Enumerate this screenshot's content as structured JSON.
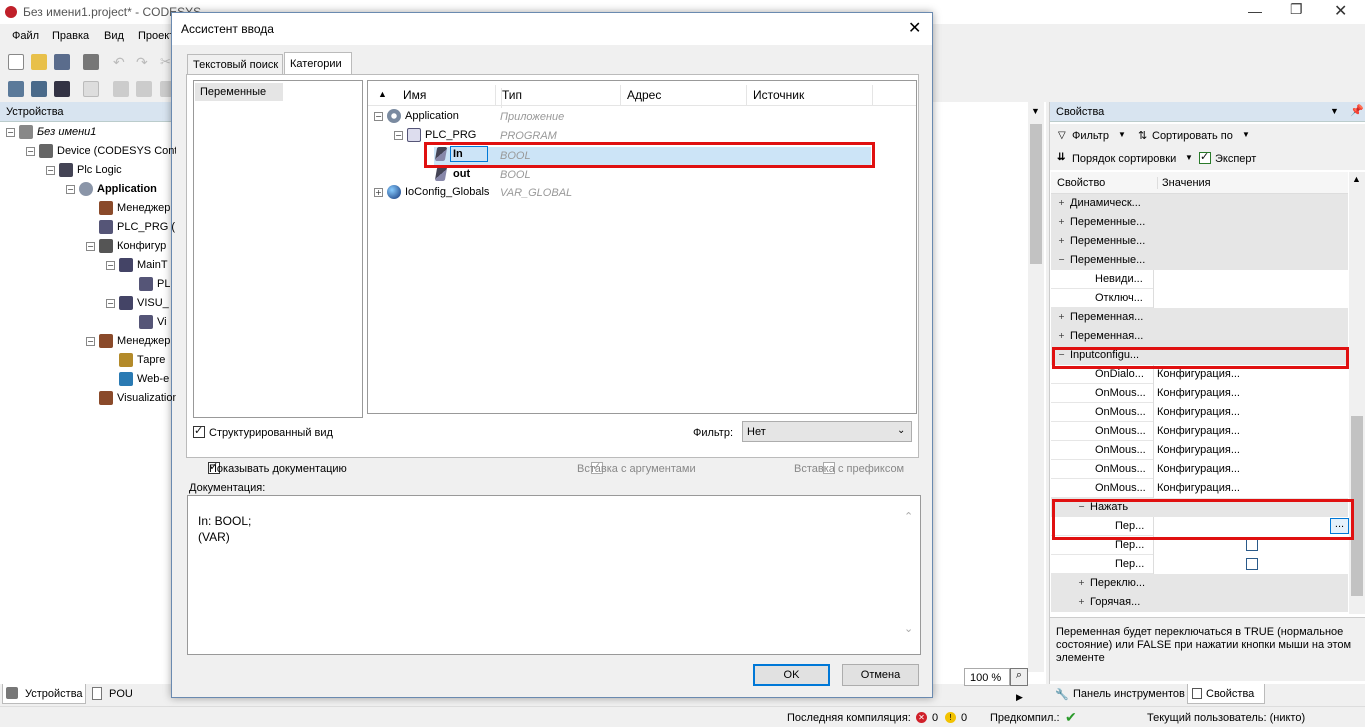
{
  "app": {
    "title": "Без имени1.project* - CODESYS"
  },
  "menu": [
    "Файл",
    "Правка",
    "Вид",
    "Проект"
  ],
  "devices": {
    "title": "Устройства",
    "tree": [
      {
        "label": "Без имени1",
        "level": 0
      },
      {
        "label": "Device (CODESYS Cont",
        "level": 1
      },
      {
        "label": "Plc Logic",
        "level": 2
      },
      {
        "label": "Application",
        "level": 3
      },
      {
        "label": "Менеджер",
        "level": 4
      },
      {
        "label": "PLC_PRG (",
        "level": 4
      },
      {
        "label": "Конфигур",
        "level": 4
      },
      {
        "label": "MainT",
        "level": 5
      },
      {
        "label": "PL",
        "level": 6
      },
      {
        "label": "VISU_",
        "level": 5
      },
      {
        "label": "Vi",
        "level": 6
      },
      {
        "label": "Менеджер",
        "level": 4
      },
      {
        "label": "Тарге",
        "level": 5
      },
      {
        "label": "Web-e",
        "level": 5
      },
      {
        "label": "Visualization",
        "level": 4
      }
    ],
    "bottom_tabs": [
      "Устройства",
      "POU"
    ]
  },
  "dialog": {
    "title": "Ассистент ввода",
    "tabs": [
      "Текстовый поиск",
      "Категории"
    ],
    "category": "Переменные",
    "columns": [
      "Имя",
      "Тип",
      "Адрес",
      "Источник"
    ],
    "rows": [
      {
        "name": "Application",
        "type": "Приложение"
      },
      {
        "name": "PLC_PRG",
        "type": "PROGRAM"
      },
      {
        "name": "In",
        "type": "BOOL"
      },
      {
        "name": "out",
        "type": "BOOL"
      },
      {
        "name": "IoConfig_Globals",
        "type": "VAR_GLOBAL"
      }
    ],
    "structured_view_label": "Структурированный вид",
    "filter_label": "Фильтр:",
    "filter_value": "Нет",
    "show_doc_label": "Показывать документацию",
    "insert_args_label": "Вставка с аргументами",
    "insert_prefix_label": "Вставка с префиксом",
    "doc_label": "Документация:",
    "doc_line1": "In: BOOL;",
    "doc_line2": "(VAR)",
    "ok_label": "OK",
    "cancel_label": "Отмена"
  },
  "editor": {
    "zoom": "100 %"
  },
  "properties": {
    "title": "Свойства",
    "filter_label": "Фильтр",
    "sort_by_label": "Сортировать по",
    "sort_order_label": "Порядок сортировки",
    "expert_label": "Эксперт",
    "col_property": "Свойство",
    "col_values": "Значения",
    "rows": [
      {
        "name": "Динамическ...",
        "value": "",
        "indent": 0,
        "group": true,
        "exp": "+"
      },
      {
        "name": "Переменные...",
        "value": "",
        "indent": 0,
        "group": true,
        "exp": "+"
      },
      {
        "name": "Переменные...",
        "value": "",
        "indent": 0,
        "group": true,
        "exp": "+"
      },
      {
        "name": "Переменные...",
        "value": "",
        "indent": 0,
        "group": true,
        "exp": "−"
      },
      {
        "name": "Невиди...",
        "value": "",
        "indent": 2,
        "group": false,
        "exp": ""
      },
      {
        "name": "Отключ...",
        "value": "",
        "indent": 2,
        "group": false,
        "exp": ""
      },
      {
        "name": "Переменная...",
        "value": "",
        "indent": 0,
        "group": true,
        "exp": "+"
      },
      {
        "name": "Переменная...",
        "value": "",
        "indent": 0,
        "group": true,
        "exp": "+"
      },
      {
        "name": "Inputconfigu...",
        "value": "",
        "indent": 0,
        "group": true,
        "exp": "−"
      },
      {
        "name": "OnDialo...",
        "value": "Конфигурация...",
        "indent": 2,
        "group": false,
        "exp": ""
      },
      {
        "name": "OnMous...",
        "value": "Конфигурация...",
        "indent": 2,
        "group": false,
        "exp": ""
      },
      {
        "name": "OnMous...",
        "value": "Конфигурация...",
        "indent": 2,
        "group": false,
        "exp": ""
      },
      {
        "name": "OnMous...",
        "value": "Конфигурация...",
        "indent": 2,
        "group": false,
        "exp": ""
      },
      {
        "name": "OnMous...",
        "value": "Конфигурация...",
        "indent": 2,
        "group": false,
        "exp": ""
      },
      {
        "name": "OnMous...",
        "value": "Конфигурация...",
        "indent": 2,
        "group": false,
        "exp": ""
      },
      {
        "name": "OnMous...",
        "value": "Конфигурация...",
        "indent": 2,
        "group": false,
        "exp": ""
      },
      {
        "name": "Нажать",
        "value": "",
        "indent": 1,
        "group": true,
        "exp": "−"
      },
      {
        "name": "Пер...",
        "value": "",
        "indent": 3,
        "group": false,
        "exp": "",
        "widget": "ellipsis"
      },
      {
        "name": "Пер...",
        "value": "",
        "indent": 3,
        "group": false,
        "exp": "",
        "widget": "checkbox"
      },
      {
        "name": "Пер...",
        "value": "",
        "indent": 3,
        "group": false,
        "exp": "",
        "widget": "checkbox"
      },
      {
        "name": "Переклю...",
        "value": "",
        "indent": 1,
        "group": true,
        "exp": "+"
      },
      {
        "name": "Горячая...",
        "value": "",
        "indent": 1,
        "group": true,
        "exp": "+"
      }
    ],
    "ellipsis": "...",
    "description": "Переменная будет переключаться в TRUE (нормальное состояние) или FALSE при нажатии кнопки мыши на этом элементе",
    "bottom_tabs": [
      "Панель инструментов",
      "Свойства"
    ]
  },
  "status": {
    "last_compile": "Последняя компиляция:",
    "errors": "0",
    "warnings": "0",
    "precompile": "Предкомпил.:",
    "current_user": "Текущий пользователь: (никто)"
  },
  "colors": {
    "highlight_red": "#e01010",
    "selection_blue": "#cce4f7",
    "accent": "#0078d7"
  }
}
